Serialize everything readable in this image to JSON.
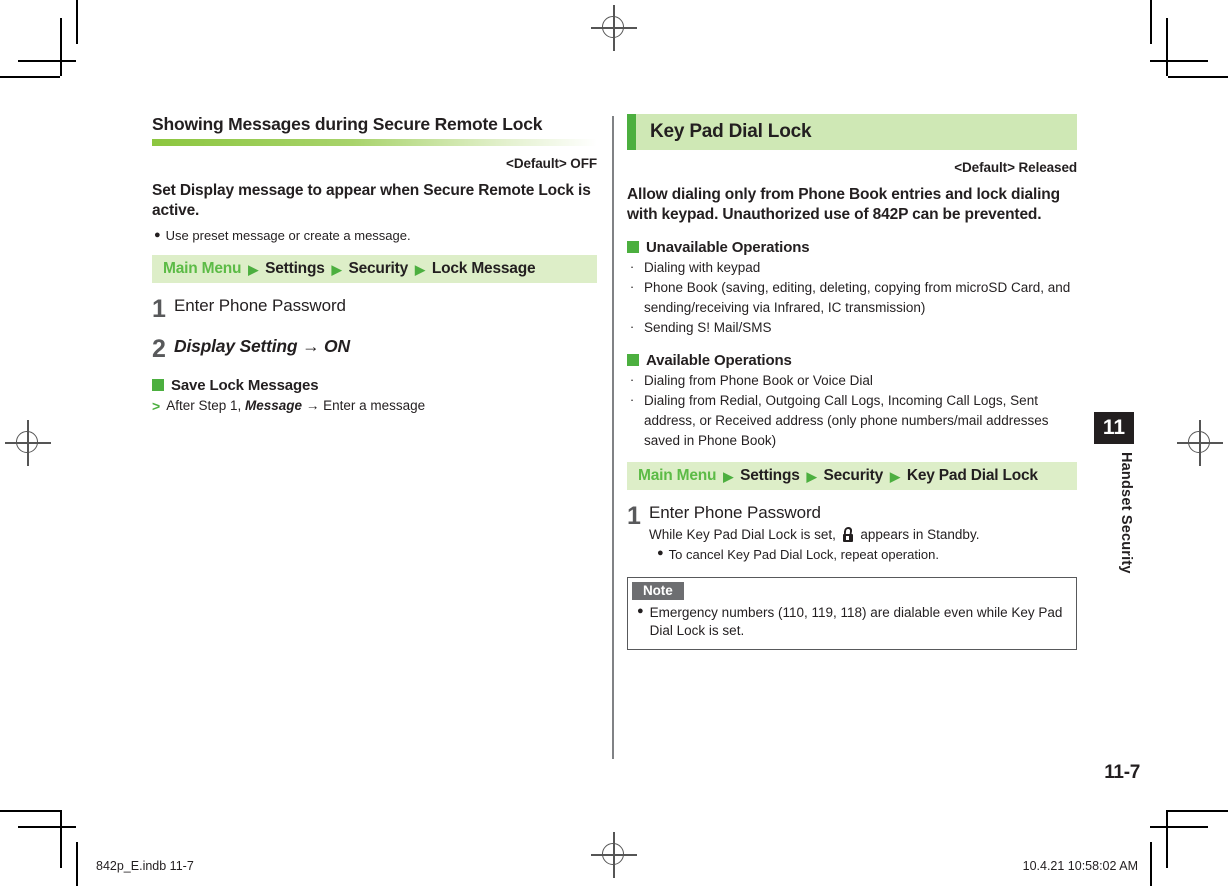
{
  "page": {
    "number": "11-7",
    "chapter_number": "11",
    "chapter_label": "Handset Security"
  },
  "footer": {
    "file": "842p_E.indb   11-7",
    "timestamp": "10.4.21   10:58:02 AM"
  },
  "left_column": {
    "section_title": "Showing Messages during Secure Remote Lock",
    "default_line": "<Default> OFF",
    "lead": "Set Display message to appear when Secure Remote Lock is active.",
    "note_dot": "Use preset message or create a message.",
    "breadcrumb": {
      "root": "Main Menu",
      "nodes": [
        "Settings",
        "Security",
        "Lock Message"
      ]
    },
    "steps": [
      {
        "num": "1",
        "label": "Enter Phone Password"
      },
      {
        "num": "2",
        "label": "Display Setting → ON"
      }
    ],
    "subsection": {
      "heading": "Save Lock Messages",
      "gt_prefix": "After Step 1,",
      "gt_italic": "Message",
      "gt_suffix": "→ Enter a message"
    }
  },
  "right_column": {
    "banner_title": "Key Pad Dial Lock",
    "default_line": "<Default> Released",
    "lead": "Allow dialing only from Phone Book entries and lock dialing with keypad. Unauthorized use of 842P can be prevented.",
    "unavailable": {
      "heading": "Unavailable Operations",
      "items": [
        "Dialing with keypad",
        "Phone Book (saving, editing, deleting, copying from microSD Card, and sending/receiving via Infrared, IC transmission)",
        "Sending S! Mail/SMS"
      ]
    },
    "available": {
      "heading": "Available Operations",
      "items": [
        "Dialing from Phone Book or Voice Dial",
        "Dialing from Redial, Outgoing Call Logs, Incoming Call Logs, Sent address, or Received address (only phone numbers/mail addresses saved in Phone Book)"
      ]
    },
    "breadcrumb": {
      "root": "Main Menu",
      "nodes": [
        "Settings",
        "Security",
        "Key Pad Dial Lock"
      ]
    },
    "step": {
      "num": "1",
      "label": "Enter Phone Password",
      "sub_before": "While Key Pad Dial Lock is set,",
      "sub_after": "appears in Standby.",
      "sub_dot": "To cancel Key Pad Dial Lock, repeat operation."
    },
    "note": {
      "tab_label": "Note",
      "text": "Emergency numbers (110, 119, 118) are dialable even while Key Pad Dial Lock is set."
    }
  },
  "colors": {
    "accent_green": "#4caf3f",
    "banner_bg": "#cfe8b5",
    "crumb_bg": "#ddeec8",
    "crumb_root": "#5cbb46",
    "note_tab_bg": "#6d6e71",
    "text": "#231f20"
  }
}
